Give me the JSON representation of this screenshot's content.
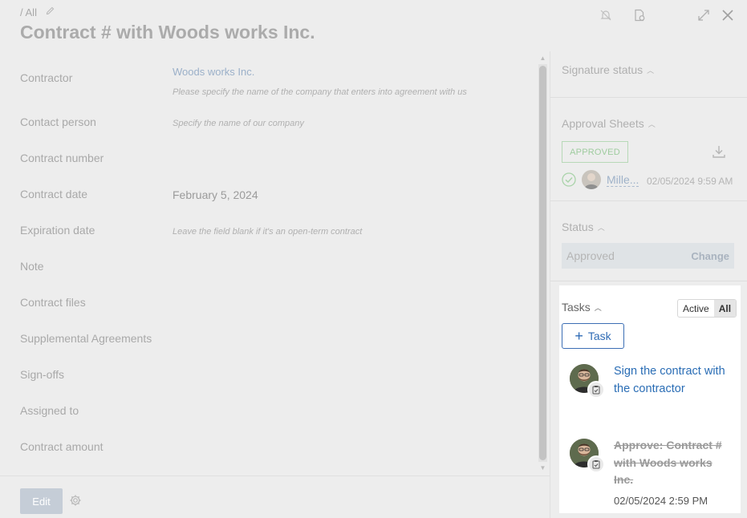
{
  "header": {
    "breadcrumb": "/ All",
    "title": "Contract # with Woods works Inc."
  },
  "icons": {
    "edit": "pencil-icon",
    "unsubscribe": "bell-off-icon",
    "document": "document-settings-icon",
    "expand": "expand-icon",
    "close": "close-icon",
    "settings": "gear-icon",
    "download": "download-icon",
    "check": "check-circle-icon",
    "task_badge": "clipboard-icon"
  },
  "form": {
    "fields": [
      {
        "label": "Contractor",
        "value": "Woods works Inc.",
        "hint": "Please specify the name of the company that enters into agreement with us"
      },
      {
        "label": "Contact person",
        "value": "",
        "hint": "Specify the name of our company"
      },
      {
        "label": "Contract number",
        "value": "",
        "hint": ""
      },
      {
        "label": "Contract date",
        "value": "February 5, 2024",
        "hint": ""
      },
      {
        "label": "Expiration date",
        "value": "",
        "hint": "Leave the field blank if it's an open-term contract"
      },
      {
        "label": "Note",
        "value": "",
        "hint": ""
      },
      {
        "label": "Contract files",
        "value": "",
        "hint": ""
      },
      {
        "label": "Supplemental Agreements",
        "value": "",
        "hint": ""
      },
      {
        "label": "Sign-offs",
        "value": "",
        "hint": ""
      },
      {
        "label": "Assigned to",
        "value": "",
        "hint": ""
      },
      {
        "label": "Contract amount",
        "value": "",
        "hint": ""
      }
    ]
  },
  "footer": {
    "edit_label": "Edit"
  },
  "sidebar": {
    "signature_status": "Signature status",
    "approval_sheets": "Approval Sheets",
    "approved_badge": "APPROVED",
    "approver_name": "Mille...",
    "approver_time": "02/05/2024 9:59 AM",
    "status_title": "Status",
    "status_value": "Approved",
    "status_change": "Change"
  },
  "tasks": {
    "title": "Tasks",
    "filter_active": "Active",
    "filter_all": "All",
    "add_label": "Task",
    "items": [
      {
        "text": "Sign the contract with the contractor",
        "done": false,
        "date": ""
      },
      {
        "text": "Approve: Contract # with Woods works Inc.",
        "done": true,
        "date": "02/05/2024 2:59 PM"
      }
    ]
  },
  "colors": {
    "accent": "#2a6db5",
    "approved_green": "#9fcc9f",
    "overlay_bg": "#ededed"
  }
}
